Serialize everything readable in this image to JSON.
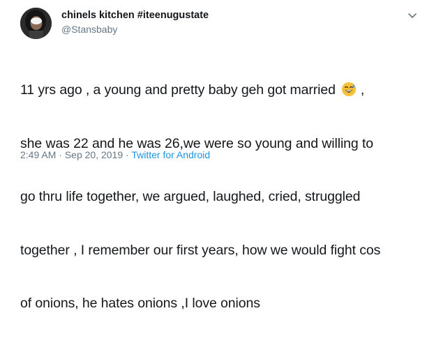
{
  "tweet": {
    "display_name": "chinels kitchen #iteenugustate",
    "handle": "@Stansbaby",
    "text_line_1a": "11 yrs ago , a young and pretty baby geh got married",
    "text_line_1b": ",",
    "text_line_2": "she was 22 and he was 26,we were so young and willing to",
    "text_line_3": "go thru life together, we argued,  laughed, cried, struggled",
    "text_line_4": "together , I remember our first years, how we would fight cos",
    "text_line_5": "of onions, he hates onions ,I love onions",
    "emoji": "grinning-face-with-sweat-emoji",
    "time": "2:49 AM",
    "separator_1": " · ",
    "date": "Sep 20, 2019",
    "separator_2": " · ",
    "source": "Twitter for Android"
  },
  "colors": {
    "text": "#14171a",
    "secondary": "#657786",
    "link": "#1b95e0",
    "emoji_face": "#f7c23a",
    "sweat": "#5ea9e6"
  },
  "icons": {
    "avatar": "user-avatar",
    "caret": "chevron-down-icon"
  }
}
